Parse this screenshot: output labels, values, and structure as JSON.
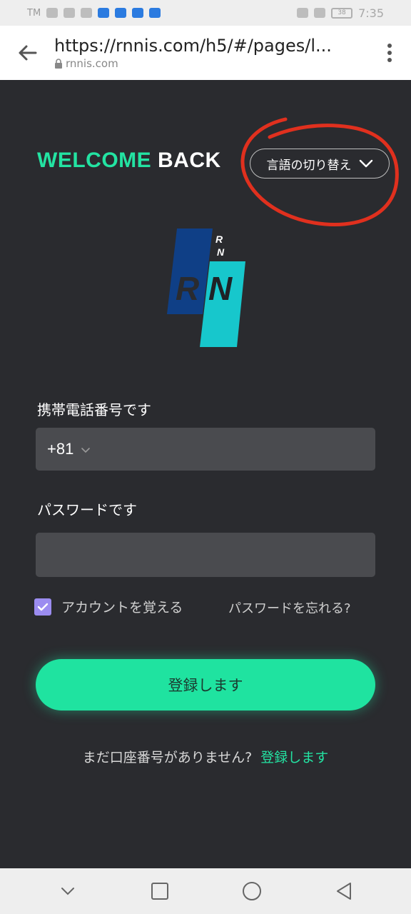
{
  "status_bar": {
    "carrier": "TM",
    "time": "7:35",
    "battery": "38"
  },
  "browser": {
    "url": "https://rnnis.com/h5/#/pages/l...",
    "domain": "rnnis.com"
  },
  "header": {
    "welcome_part1": "WELCOME",
    "welcome_part2": "BACK",
    "language_button": "言語の切り替え"
  },
  "logo": {
    "letters_small": "RN",
    "letters_large": "RN"
  },
  "form": {
    "phone_label": "携帯電話番号です",
    "country_code": "+81",
    "phone_value": "",
    "password_label": "パスワードです",
    "password_value": "",
    "remember_label": "アカウントを覚える",
    "remember_checked": true,
    "forgot_link": "パスワードを忘れる?",
    "login_button": "登録します"
  },
  "signup": {
    "prompt": "まだ口座番号がありません?",
    "link": "登録します"
  },
  "colors": {
    "accent": "#23e3a2",
    "background": "#2a2b2f",
    "field": "#4a4b4f",
    "checkbox": "#9b8cf0",
    "annotation": "#e0301e"
  },
  "icons": {
    "back": "arrow-left-icon",
    "menu": "more-vertical-icon",
    "lock": "lock-icon",
    "chevron": "chevron-down-icon",
    "nav": [
      "chevron-down-icon",
      "square-icon",
      "circle-icon",
      "triangle-back-icon"
    ]
  }
}
